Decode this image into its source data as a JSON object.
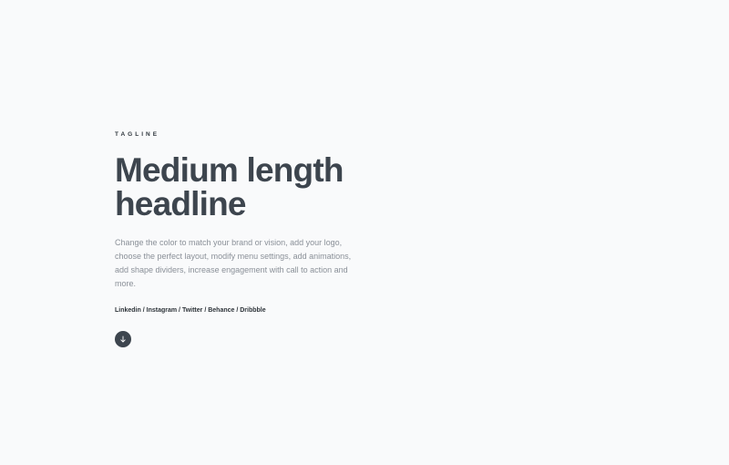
{
  "hero": {
    "tagline": "TAGLINE",
    "headline": "Medium length headline",
    "description": "Change the color to match your brand or vision, add your logo, choose the perfect layout, modify menu settings, add animations, add shape dividers, increase engagement with call to action and more.",
    "social_links": [
      "Linkedin",
      "Instagram",
      "Twitter",
      "Behance",
      "Dribbble"
    ],
    "social_separator": " / ",
    "scroll_icon": "arrow-down-icon"
  },
  "colors": {
    "background": "#f9fafb",
    "text_dark": "#3d454e",
    "text_muted": "#8a9098",
    "button": "#3d454e"
  }
}
